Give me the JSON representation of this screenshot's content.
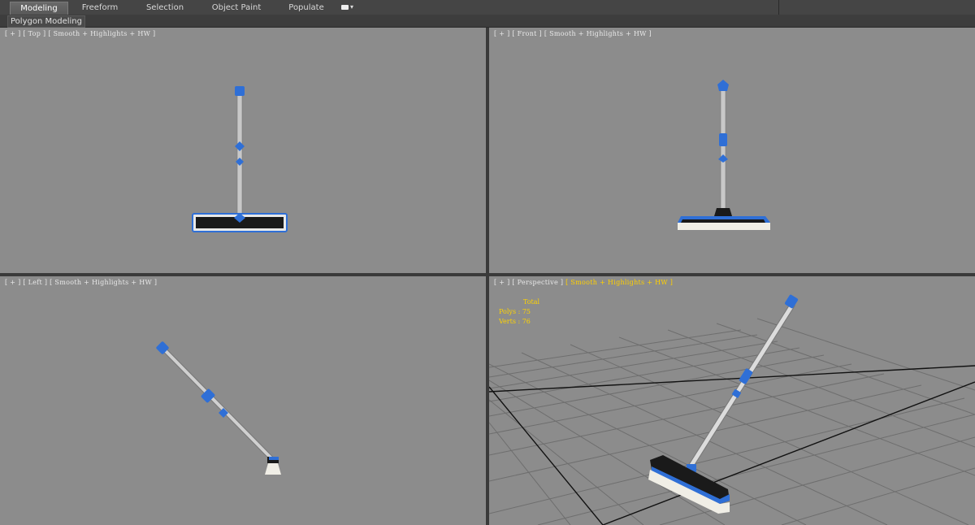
{
  "ribbon": {
    "tabs": [
      {
        "label": "Modeling",
        "active": true
      },
      {
        "label": "Freeform",
        "active": false
      },
      {
        "label": "Selection",
        "active": false
      },
      {
        "label": "Object Paint",
        "active": false
      },
      {
        "label": "Populate",
        "active": false
      }
    ],
    "dropdown_icon": "chevron-down-icon"
  },
  "subbar": {
    "label": "Polygon Modeling"
  },
  "viewports": {
    "top": {
      "plus": "[ + ]",
      "name": "[ Top ]",
      "shading": "[ Smooth + Highlights + HW ]"
    },
    "front": {
      "plus": "[ + ]",
      "name": "[ Front ]",
      "shading": "[ Smooth + Highlights + HW ]"
    },
    "left": {
      "plus": "[ + ]",
      "name": "[ Left ]",
      "shading": "[ Smooth + Highlights + HW ]"
    },
    "perspective": {
      "plus": "[ + ]",
      "name": "[ Perspective ]",
      "shading": "[ Smooth + Highlights + HW ]"
    }
  },
  "stats": {
    "total": "Total",
    "polys": "Polys : 75",
    "verts": "Verts : 76"
  },
  "colors": {
    "viewport_bg": "#8c8c8c",
    "accent_blue": "#2f6fd6",
    "label_yellow": "#ffd400"
  }
}
